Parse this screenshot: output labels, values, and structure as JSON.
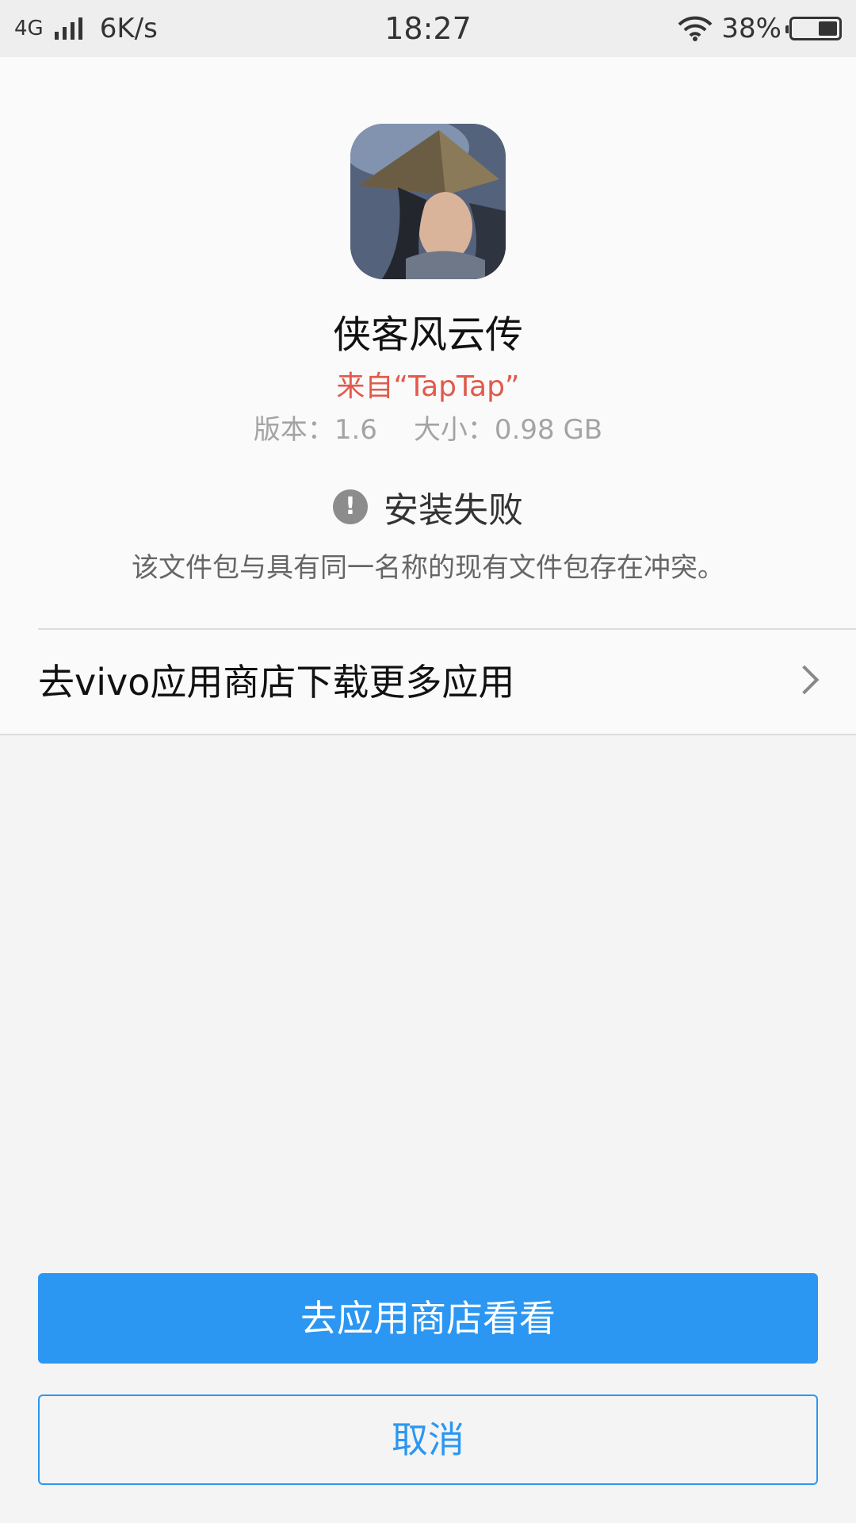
{
  "status_bar": {
    "network": "4G",
    "speed": "6K/s",
    "time": "18:27",
    "battery": "38%",
    "icons": [
      "signal-icon",
      "wifi-icon",
      "battery-icon"
    ]
  },
  "app": {
    "icon": "game-app-icon",
    "name": "侠客风云传",
    "source": "来自“TapTap”",
    "version": "版本：1.6",
    "size": "大小：0.98 GB"
  },
  "install_result": {
    "icon": "alert-icon",
    "title": "安装失败",
    "message": "该文件包与具有同一名称的现有文件包存在冲突。"
  },
  "store_link": {
    "label": "去vivo应用商店下载更多应用",
    "icon": "chevron-right-icon"
  },
  "buttons": {
    "primary": "去应用商店看看",
    "secondary": "取消"
  },
  "colors": {
    "accent": "#2b97f2",
    "source_text": "#e15a4b",
    "panel_bg": "#fafafa",
    "page_bg": "#f4f4f4"
  }
}
